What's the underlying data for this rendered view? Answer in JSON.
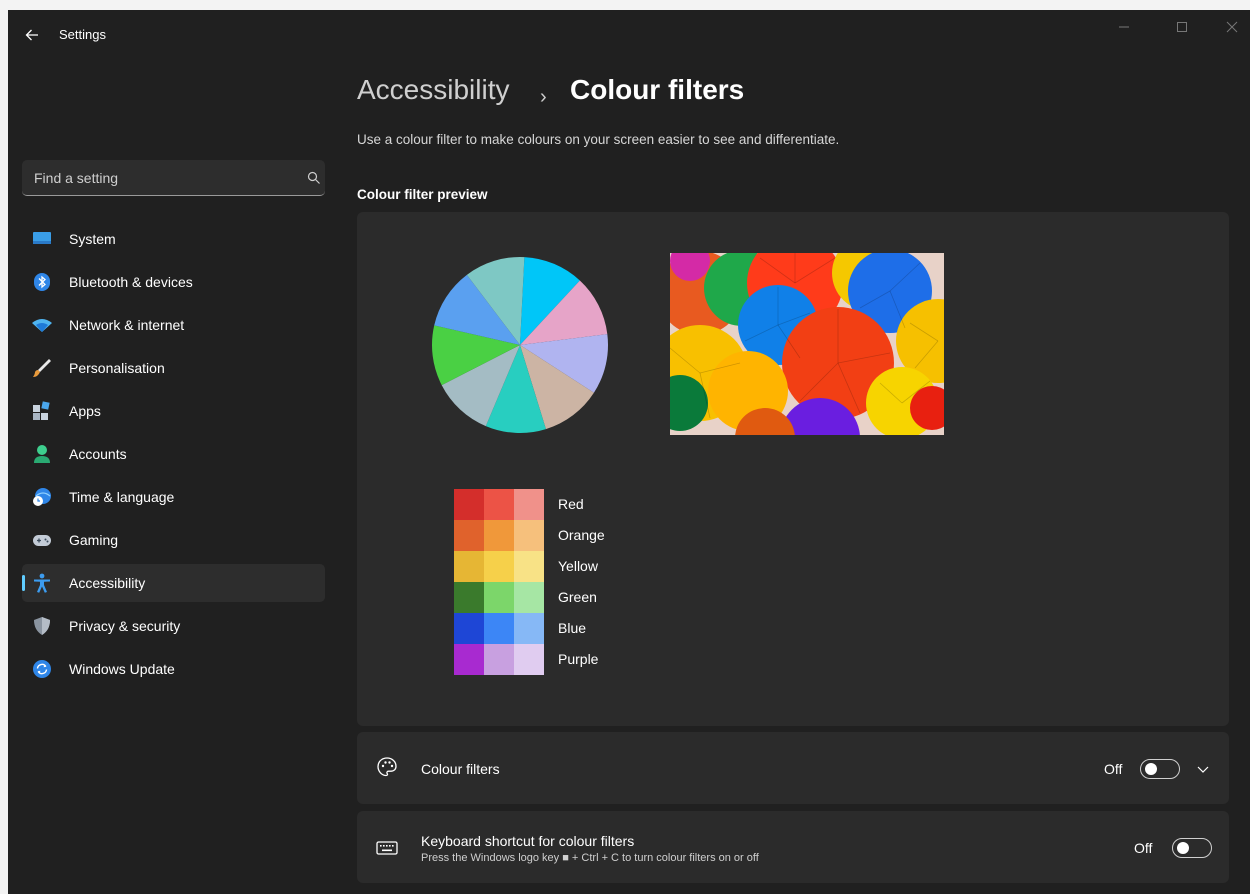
{
  "app": {
    "title": "Settings",
    "back_icon": "back-arrow-icon"
  },
  "window_controls": [
    "minimize",
    "maximize",
    "close"
  ],
  "search": {
    "placeholder": "Find a setting",
    "value": ""
  },
  "sidebar": {
    "items": [
      {
        "label": "System",
        "icon": "system-icon"
      },
      {
        "label": "Bluetooth & devices",
        "icon": "bluetooth-icon"
      },
      {
        "label": "Network & internet",
        "icon": "network-icon"
      },
      {
        "label": "Personalisation",
        "icon": "brush-icon"
      },
      {
        "label": "Apps",
        "icon": "apps-icon"
      },
      {
        "label": "Accounts",
        "icon": "accounts-icon"
      },
      {
        "label": "Time & language",
        "icon": "time-language-icon"
      },
      {
        "label": "Gaming",
        "icon": "gaming-icon"
      },
      {
        "label": "Accessibility",
        "icon": "accessibility-icon",
        "selected": true
      },
      {
        "label": "Privacy & security",
        "icon": "shield-icon"
      },
      {
        "label": "Windows Update",
        "icon": "update-icon"
      }
    ]
  },
  "breadcrumb": {
    "parent": "Accessibility",
    "separator": "›",
    "current": "Colour filters"
  },
  "description": "Use a colour filter to make colours on your screen easier to see and differentiate.",
  "preview": {
    "title": "Colour filter preview",
    "pie_colors": [
      "#00c6f8",
      "#e6a4c8",
      "#b0b4f0",
      "#ccb4a4",
      "#28cec0",
      "#a4bcc4",
      "#4ad044",
      "#5aa0f0",
      "#7ec8c4"
    ],
    "swatches": [
      {
        "label": "Red",
        "colors": [
          "#d42e2b",
          "#ec5346",
          "#f0918a"
        ]
      },
      {
        "label": "Orange",
        "colors": [
          "#e0622c",
          "#f0983a",
          "#f6c07c"
        ]
      },
      {
        "label": "Yellow",
        "colors": [
          "#e6b634",
          "#f6d04a",
          "#f8e286"
        ]
      },
      {
        "label": "Green",
        "colors": [
          "#3a7a2c",
          "#7cd66a",
          "#a6e6a4"
        ]
      },
      {
        "label": "Blue",
        "colors": [
          "#1e46d6",
          "#3c86f6",
          "#86b8f6"
        ]
      },
      {
        "label": "Purple",
        "colors": [
          "#a82ad0",
          "#c8a0e0",
          "#e0ccf0"
        ]
      }
    ]
  },
  "cards": {
    "colour_filters": {
      "title": "Colour filters",
      "state": "Off",
      "icon": "palette-icon",
      "expand_icon": "chevron-down-icon"
    },
    "shortcut": {
      "title": "Keyboard shortcut for colour filters",
      "subtitle": "Press the Windows logo key ■ + Ctrl + C to turn colour filters on or off",
      "state": "Off",
      "icon": "keyboard-icon"
    }
  }
}
